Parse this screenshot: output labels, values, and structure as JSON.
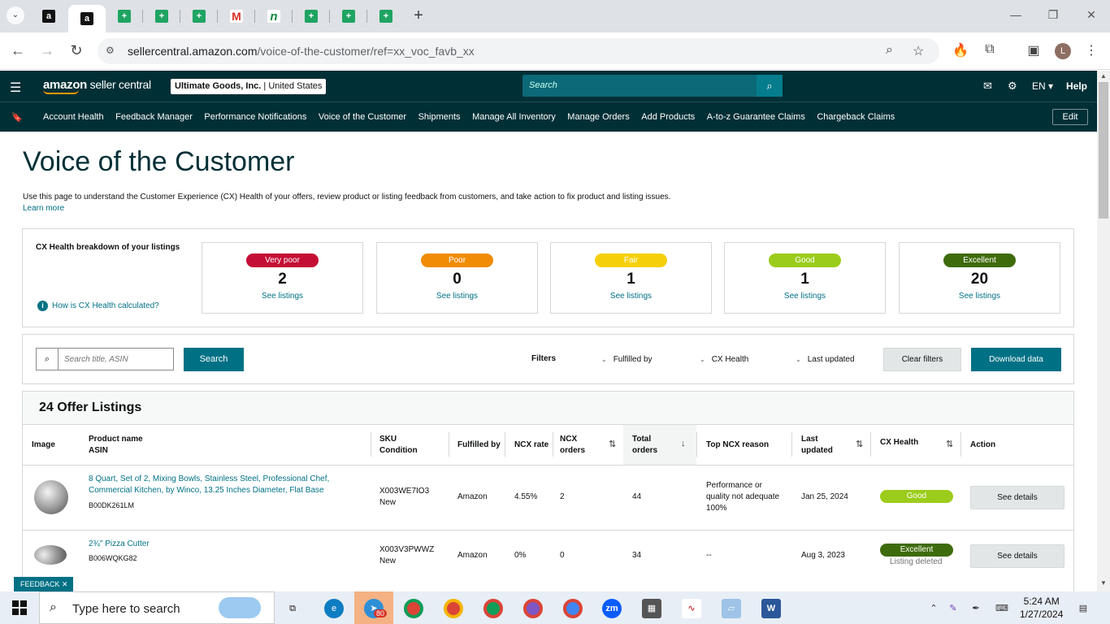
{
  "browser": {
    "url_host": "sellercentral.amazon.com",
    "url_path": "/voice-of-the-customer/ref=xx_voc_favb_xx",
    "gmail_letter": "M",
    "sheet_letter": "+",
    "amazon_letter": "a",
    "n_letter": "n"
  },
  "header": {
    "brand": "amazon",
    "brand_suffix": " seller central",
    "account_name": "Ultimate Goods, Inc.",
    "account_region": " | United States",
    "search_placeholder": "Search",
    "lang": "EN ▾",
    "help": "Help"
  },
  "nav": {
    "items": [
      "Account Health",
      "Feedback Manager",
      "Performance Notifications",
      "Voice of the Customer",
      "Shipments",
      "Manage All Inventory",
      "Manage Orders",
      "Add Products",
      "A-to-z Guarantee Claims",
      "Chargeback Claims"
    ],
    "edit": "Edit"
  },
  "page": {
    "title": "Voice of the Customer",
    "intro": "Use this page to understand the Customer Experience (CX) Health of your offers, review product or listing feedback from customers, and take action to fix product and listing issues.",
    "learn_more": "Learn more"
  },
  "cx": {
    "title": "CX Health breakdown of your listings",
    "how": "How is CX Health calculated?",
    "info_glyph": "i",
    "cards": [
      {
        "label": "Very poor",
        "count": "2",
        "link": "See listings",
        "color": "#c40e35",
        "text": "#fff"
      },
      {
        "label": "Poor",
        "count": "0",
        "link": "See listings",
        "color": "#f08c06",
        "text": "#fff"
      },
      {
        "label": "Fair",
        "count": "1",
        "link": "See listings",
        "color": "#f5d00a",
        "text": "#fff"
      },
      {
        "label": "Good",
        "count": "1",
        "link": "See listings",
        "color": "#9ccc1b",
        "text": "#fff"
      },
      {
        "label": "Excellent",
        "count": "20",
        "link": "See listings",
        "color": "#3e6b0c",
        "text": "#fff"
      }
    ]
  },
  "filters": {
    "search_placeholder": "Search title, ASIN",
    "search_btn": "Search",
    "label": "Filters",
    "fulfilled_by": "Fulfilled by",
    "cx_health": "CX Health",
    "last_updated": "Last updated",
    "clear": "Clear filters",
    "download": "Download data"
  },
  "table": {
    "title": "24 Offer Listings",
    "headers": {
      "image": "Image",
      "product": "Product name",
      "asin": "ASIN",
      "sku": "SKU",
      "condition": "Condition",
      "fulfilled": "Fulfilled by",
      "ncx_rate": "NCX rate",
      "ncx_orders_1": "NCX",
      "ncx_orders_2": "orders",
      "total_orders_1": "Total",
      "total_orders_2": "orders",
      "top_reason": "Top NCX reason",
      "last_updated_1": "Last",
      "last_updated_2": "updated",
      "cx_health": "CX Health",
      "action": "Action"
    },
    "rows": [
      {
        "name_line1": "8 Quart, Set of 2, Mixing Bowls, Stainless Steel, Professional Chef,",
        "name_line2": "Commercial Kitchen, by Winco, 13.25 Inches Diameter, Flat Base",
        "asin": "B00DK261LM",
        "sku": "X003WE7IO3",
        "condition": "New",
        "fulfilled": "Amazon",
        "ncx_rate": "4.55%",
        "ncx_orders": "2",
        "total_orders": "44",
        "reason_1": "Performance or",
        "reason_2": "quality not adequate",
        "reason_3": "100%",
        "updated": "Jan 25, 2024",
        "health": "Good",
        "health_color": "#9ccc1b",
        "health_note": "",
        "action": "See details"
      },
      {
        "name_line1": "2¾\" Pizza Cutter",
        "asin": "B006WQKG82",
        "sku": "X003V3PWWZ",
        "condition": "New",
        "fulfilled": "Amazon",
        "ncx_rate": "0%",
        "ncx_orders": "0",
        "total_orders": "34",
        "reason_1": "--",
        "updated": "Aug 3, 2023",
        "health": "Excellent",
        "health_color": "#3e6b0c",
        "health_note": "Listing deleted",
        "action": "See details"
      }
    ]
  },
  "feedback": "FEEDBACK ✕",
  "taskbar": {
    "search": "Type here to search",
    "time": "5:24 AM",
    "date": "1/27/2024",
    "badge": "80",
    "zoom": "zm"
  }
}
